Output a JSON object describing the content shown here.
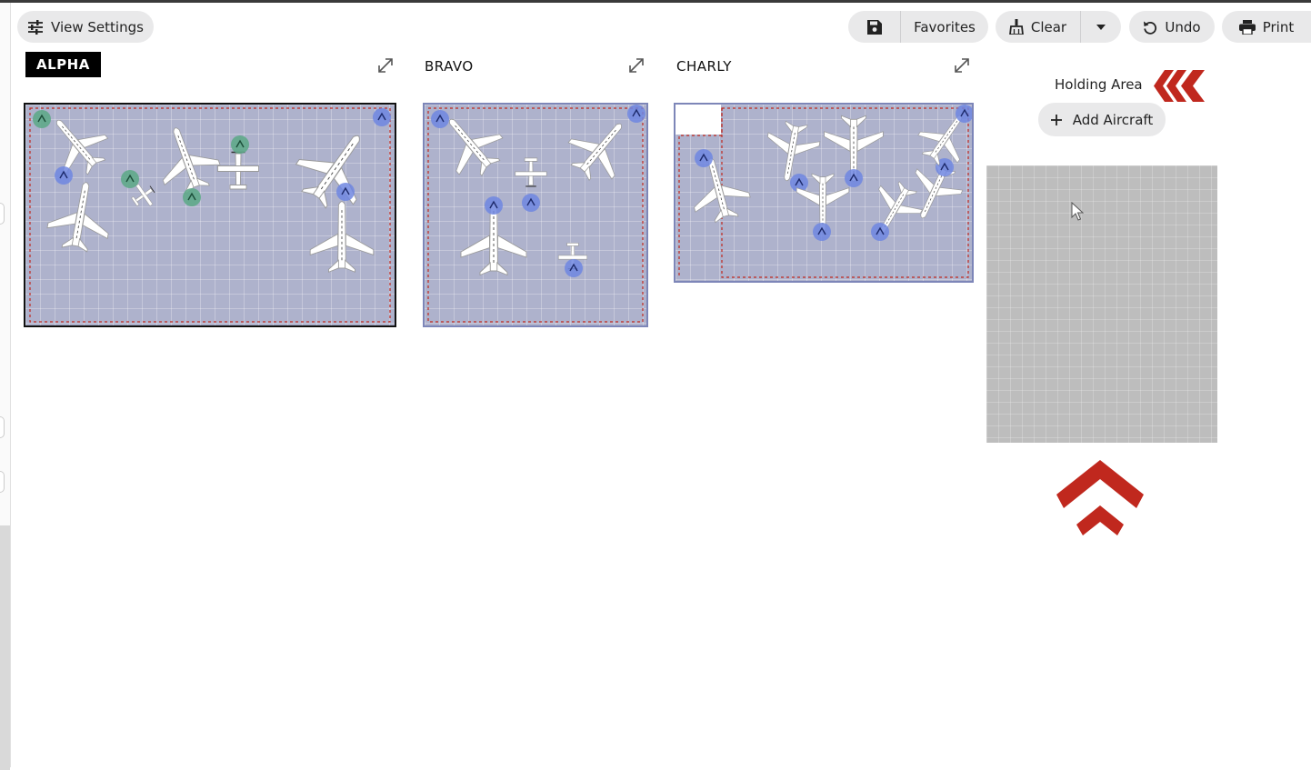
{
  "toolbar": {
    "view_settings_label": "View Settings",
    "favorites_label": "Favorites",
    "clear_label": "Clear",
    "undo_label": "Undo",
    "print_label": "Print"
  },
  "hangars": [
    {
      "name": "ALPHA",
      "active": true
    },
    {
      "name": "BRAVO",
      "active": false
    },
    {
      "name": "CHARLY",
      "active": false
    }
  ],
  "holding_area": {
    "label": "Holding Area",
    "add_aircraft_label": "Add Aircraft"
  },
  "colors": {
    "accent_red": "#c0281e",
    "hangar_floor": "#aeb2cc",
    "marker_blue": "#6f86e0",
    "marker_green": "#5fa88a"
  }
}
